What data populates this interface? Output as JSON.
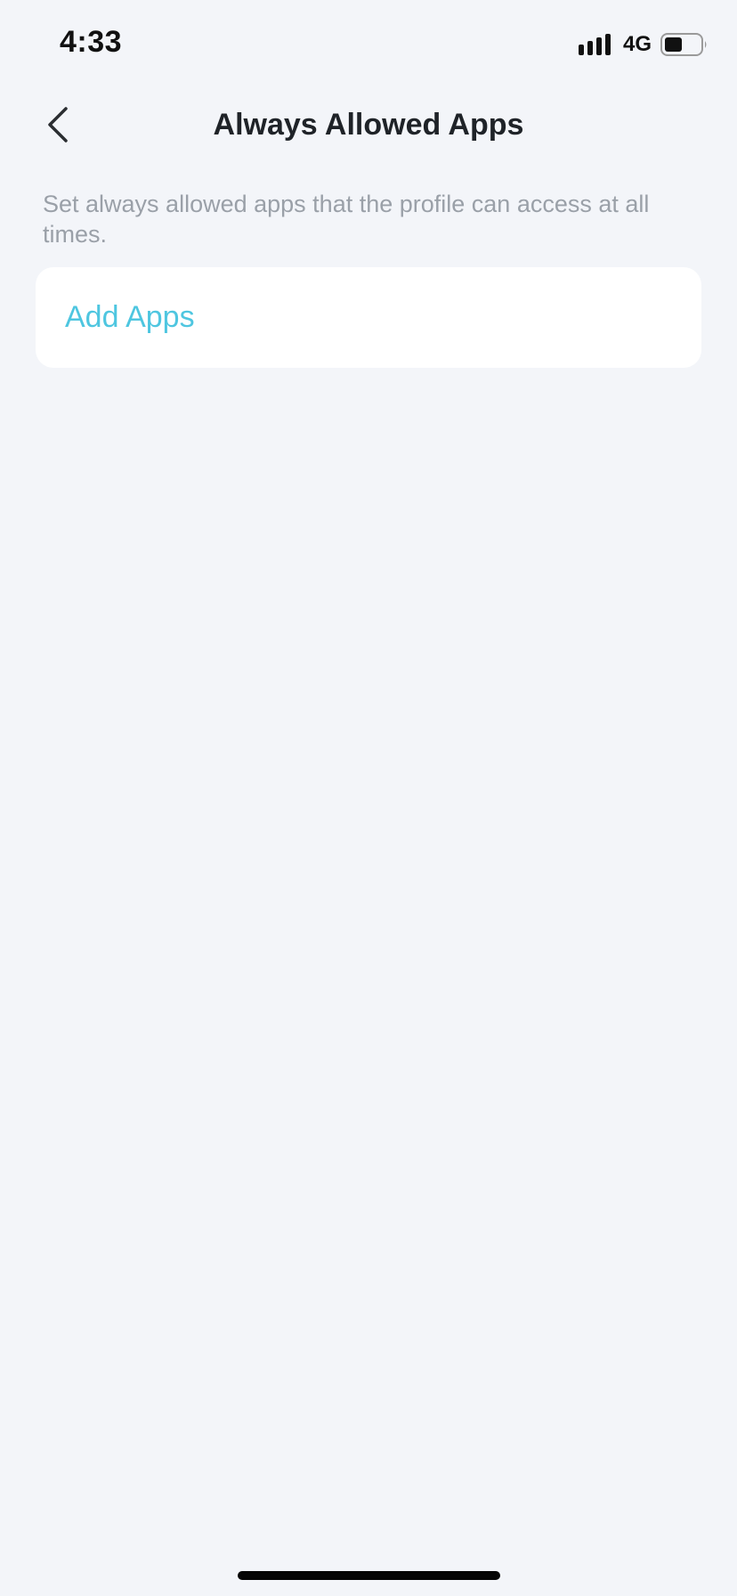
{
  "status_bar": {
    "time": "4:33",
    "network": "4G",
    "signal_icon": "cellular-signal-icon",
    "battery_icon": "battery-icon",
    "battery_level": 0.5
  },
  "header": {
    "title": "Always Allowed Apps",
    "back_icon": "chevron-left-icon"
  },
  "content": {
    "description": "Set always allowed apps that the profile can access at all times.",
    "add_apps_label": "Add Apps"
  },
  "colors": {
    "accent": "#4ec6e0",
    "background": "#f3f5f9",
    "description_text": "#9aa0a8"
  }
}
